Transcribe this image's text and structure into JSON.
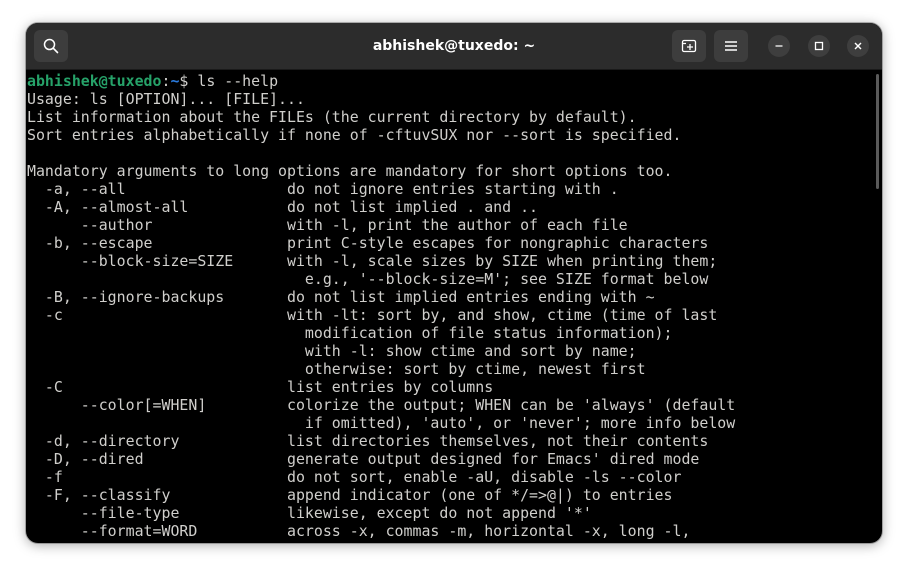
{
  "window": {
    "title": "abhishek@tuxedo: ~"
  },
  "titlebar": {
    "search_icon": "search-icon",
    "new_tab_icon": "new-tab-icon",
    "menu_icon": "hamburger-menu-icon",
    "minimize_icon": "minimize-icon",
    "maximize_icon": "maximize-icon",
    "close_icon": "close-icon"
  },
  "terminal": {
    "prompt_user": "abhishek@tuxedo",
    "prompt_sep": ":",
    "prompt_path": "~",
    "prompt_symbol": "$ ",
    "command": "ls --help",
    "lines": [
      "Usage: ls [OPTION]... [FILE]...",
      "List information about the FILEs (the current directory by default).",
      "Sort entries alphabetically if none of -cftuvSUX nor --sort is specified.",
      "",
      "Mandatory arguments to long options are mandatory for short options too.",
      "  -a, --all                  do not ignore entries starting with .",
      "  -A, --almost-all           do not list implied . and ..",
      "      --author               with -l, print the author of each file",
      "  -b, --escape               print C-style escapes for nongraphic characters",
      "      --block-size=SIZE      with -l, scale sizes by SIZE when printing them;",
      "                               e.g., '--block-size=M'; see SIZE format below",
      "  -B, --ignore-backups       do not list implied entries ending with ~",
      "  -c                         with -lt: sort by, and show, ctime (time of last",
      "                               modification of file status information);",
      "                               with -l: show ctime and sort by name;",
      "                               otherwise: sort by ctime, newest first",
      "  -C                         list entries by columns",
      "      --color[=WHEN]         colorize the output; WHEN can be 'always' (default",
      "                               if omitted), 'auto', or 'never'; more info below",
      "  -d, --directory            list directories themselves, not their contents",
      "  -D, --dired                generate output designed for Emacs' dired mode",
      "  -f                         do not sort, enable -aU, disable -ls --color",
      "  -F, --classify             append indicator (one of */=>@|) to entries",
      "      --file-type            likewise, except do not append '*'",
      "      --format=WORD          across -x, commas -m, horizontal -x, long -l,"
    ]
  },
  "colors": {
    "window_bg": "#000000",
    "titlebar_bg": "#2c2c2c",
    "text": "#d0cfcc",
    "prompt_user": "#26a269",
    "prompt_path": "#2a7bde"
  }
}
